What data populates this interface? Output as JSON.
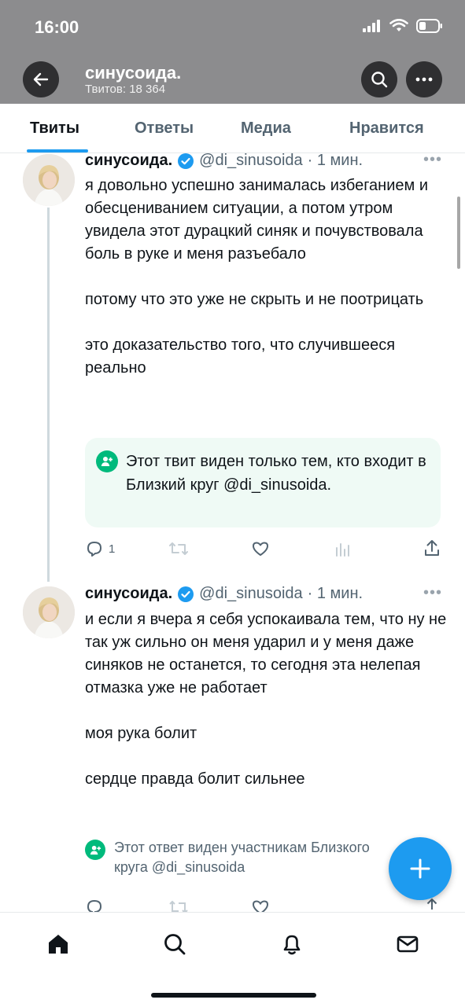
{
  "status": {
    "time": "16:00"
  },
  "header": {
    "title": "синусоида.",
    "subtitle": "Твитов: 18 364"
  },
  "tabs": [
    {
      "label": "Твиты",
      "active": true
    },
    {
      "label": "Ответы"
    },
    {
      "label": "Медиа"
    },
    {
      "label": "Нравится"
    }
  ],
  "tweets": [
    {
      "name": "синусоида.",
      "handle": "@di_sinusoida",
      "time": "· 1 мин.",
      "text": "я довольно успешно занималась избеганием и обесцениванием ситуации, а потом утром увидела этот дурацкий синяк и почувствовала боль в руке и меня разъебало\n\nпотому что это уже не скрыть и не поотрицать\n\nэто доказательство того, что случившееся реально",
      "circle_notice": "Этот твит виден только тем, кто входит в Близкий круг @di_sinusoida.",
      "reply_count": "1"
    },
    {
      "name": "синусоида.",
      "handle": "@di_sinusoida",
      "time": "· 1 мин.",
      "text": "и если я вчера я себя успокаивала тем, что ну не так уж сильно он меня ударил и у меня даже синяков не останется, то сегодня эта нелепая отмазка уже не работает\n\nмоя рука болит\n\nсердце правда болит сильнее",
      "circle_notice": "Этот ответ виден участникам Близкого круга @di_sinusoida"
    }
  ],
  "colors": {
    "accent": "#1d9bf0",
    "circle": "#00ba7c",
    "header_bg": "#8c8c8e"
  }
}
